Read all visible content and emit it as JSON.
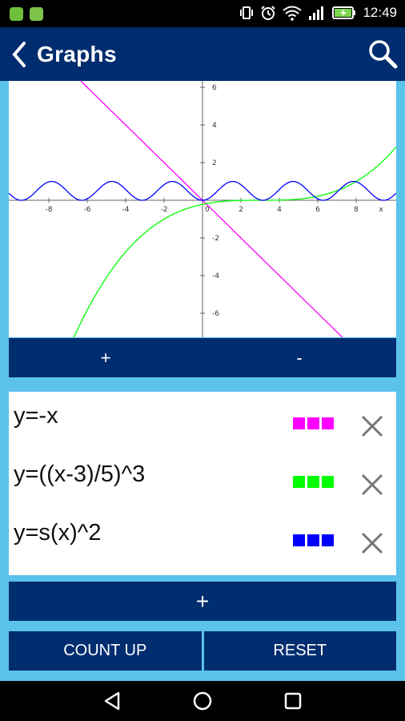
{
  "status": {
    "time": "12:49"
  },
  "appbar": {
    "title": "Graphs",
    "back_icon": "chevron-left-icon",
    "search_icon": "search-icon"
  },
  "graph": {
    "x_ticks": [
      "-8",
      "-6",
      "-4",
      "-2",
      "0",
      "2",
      "4",
      "6",
      "8"
    ],
    "x_axis_label": "x",
    "y_ticks": [
      "6",
      "4",
      "2",
      "-2",
      "-4",
      "-6"
    ]
  },
  "zoom": {
    "in_label": "+",
    "out_label": "-"
  },
  "functions": [
    {
      "expr": "y=-x",
      "color": "#ff00ff"
    },
    {
      "expr": "y=((x-3)/5)^3",
      "color": "#00ff00"
    },
    {
      "expr": "y=s(x)^2",
      "color": "#0000ff"
    }
  ],
  "add_label": "+",
  "buttons": {
    "count_up": "COUNT UP",
    "reset": "RESET"
  }
}
